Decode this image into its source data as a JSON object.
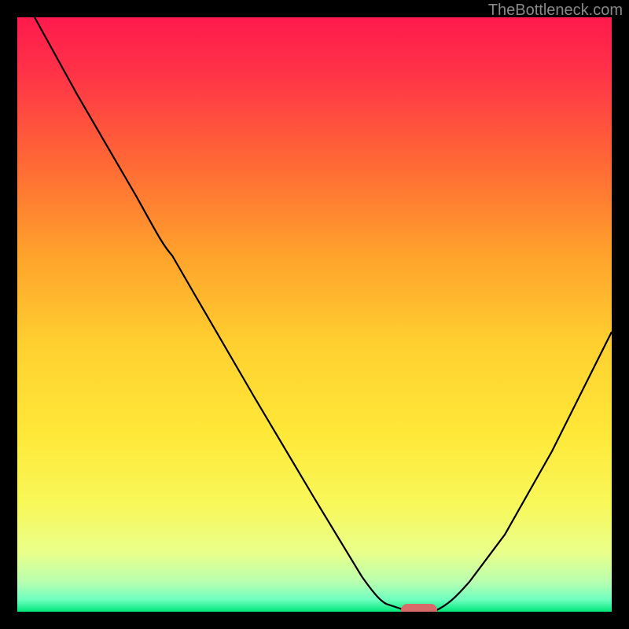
{
  "watermark": "TheBottleneck.com",
  "chart_data": {
    "type": "line",
    "title": "",
    "xlabel": "",
    "ylabel": "",
    "xlim": [
      0,
      100
    ],
    "ylim": [
      0,
      100
    ],
    "grid": false,
    "background": "red-yellow-green vertical gradient",
    "series": [
      {
        "name": "bottleneck-curve",
        "x": [
          3,
          10,
          20,
          26,
          30,
          40,
          50,
          58,
          62,
          66,
          70,
          76,
          82,
          90,
          100
        ],
        "y": [
          100,
          87,
          70,
          60,
          53,
          36,
          19,
          6,
          2,
          0,
          0,
          5,
          13,
          27,
          47
        ]
      }
    ],
    "marker": {
      "name": "optimal-point",
      "x": 68,
      "y": 0,
      "shape": "pill",
      "color": "#d86a6a"
    },
    "colors": {
      "top": "#ff1a4d",
      "mid_upper": "#ff8a2a",
      "mid": "#ffe438",
      "mid_lower": "#f4ff7a",
      "bottom": "#00e87a",
      "curve": "#000000",
      "frame": "#000000"
    }
  }
}
